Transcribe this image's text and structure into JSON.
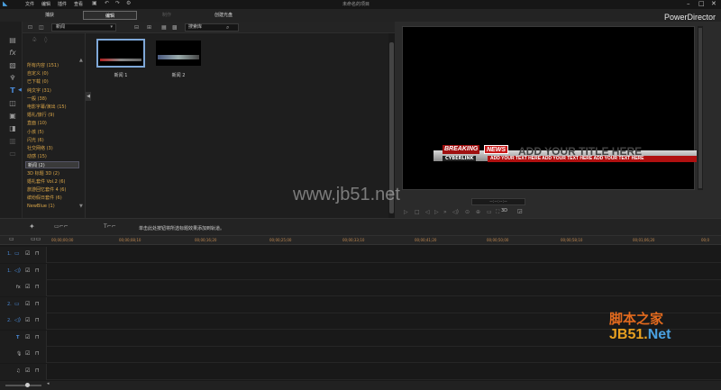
{
  "titlebar": {
    "menu": [
      "文件",
      "编辑",
      "插件",
      "查看"
    ],
    "window_title": "未命名的项目"
  },
  "modes": [
    {
      "label": "捕获",
      "state": "normal"
    },
    {
      "label": "编辑",
      "state": "active"
    },
    {
      "label": "制作",
      "state": "disabled"
    },
    {
      "label": "创建光盘",
      "state": "normal"
    }
  ],
  "brand": "PowerDirector",
  "library": {
    "category_select": "新闻",
    "search_placeholder": "搜索库",
    "categories": [
      {
        "label": "所有内容 (151)",
        "selected": false
      },
      {
        "label": "自定义 (0)",
        "selected": false
      },
      {
        "label": "已下载 (0)",
        "selected": false
      },
      {
        "label": "纯文字 (31)",
        "selected": false
      },
      {
        "label": "一般 (38)",
        "selected": false
      },
      {
        "label": "电影字幕/演出 (15)",
        "selected": false
      },
      {
        "label": "婚礼/旅行 (9)",
        "selected": false
      },
      {
        "label": "直面 (10)",
        "selected": false
      },
      {
        "label": "小孩 (5)",
        "selected": false
      },
      {
        "label": "闪光 (6)",
        "selected": false
      },
      {
        "label": "社交网络 (3)",
        "selected": false
      },
      {
        "label": "动感 (15)",
        "selected": false
      },
      {
        "label": "新闻 (2)",
        "selected": true
      },
      {
        "label": "3D 标题 3D (2)",
        "selected": false
      },
      {
        "label": "婚礼套件 Vol.2 (6)",
        "selected": false
      },
      {
        "label": "旅游回忆套件 4 (6)",
        "selected": false
      },
      {
        "label": "缤纷假日套件 (6)",
        "selected": false
      },
      {
        "label": "NewBlue (1)",
        "selected": false
      }
    ],
    "thumbnails": [
      {
        "label": "新闻 1",
        "selected": true
      },
      {
        "label": "新闻 2",
        "selected": false
      }
    ]
  },
  "preview": {
    "breaking": "BREAKING",
    "news": "NEWS",
    "title": "ADD YOUR TITLE HERE",
    "cyberlink": "CYBERLINK",
    "body_text": "ADD YOUR TEXT HERE ADD YOUR TEXT HERE ADD YOUR TEXT HERE",
    "timecode": "--:--:--:--",
    "btn_3d": "3D"
  },
  "hint_text": "单击此处按钮将所选标题效果添加到轨道。",
  "timeline": {
    "ticks": [
      "00;00;00;00",
      "00;00;08;10",
      "00;00;16;20",
      "00;00;25;00",
      "00;00;33;10",
      "00;00;41;20",
      "00;00;50;00",
      "00;00;58;10",
      "00;01;06;20",
      "00;0"
    ],
    "tracks": [
      {
        "label": "1.",
        "type": "video"
      },
      {
        "label": "1.",
        "type": "audio"
      },
      {
        "label": "fx",
        "type": "effect"
      },
      {
        "label": "2.",
        "type": "video"
      },
      {
        "label": "2.",
        "type": "audio"
      },
      {
        "label": "T",
        "type": "title"
      },
      {
        "label": "🎙",
        "type": "voice"
      },
      {
        "label": "♫",
        "type": "music"
      }
    ]
  },
  "watermarks": {
    "site": "www.jb51.net",
    "cn": "脚本之家",
    "jb": "JB51.",
    "net": "Net"
  },
  "colors": {
    "accent_orange": "#d9a548",
    "selection_blue": "#7fa8d8",
    "track_blue": "#4a8ad8",
    "news_red": "#c81818"
  }
}
